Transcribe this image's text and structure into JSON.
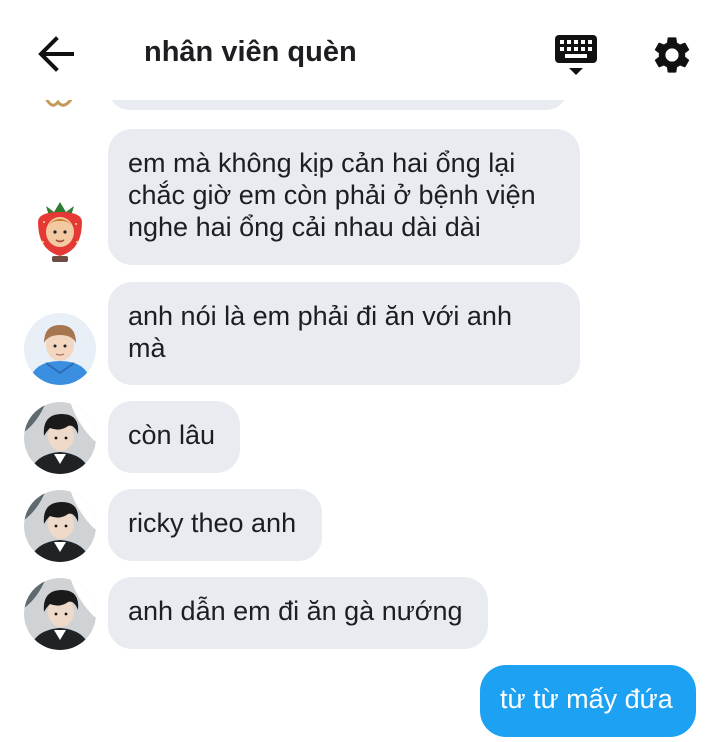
{
  "header": {
    "title": "nhân viên quèn",
    "back_icon": "arrow-left-icon",
    "keyboard_icon": "keyboard-icon",
    "settings_icon": "gear-icon"
  },
  "colors": {
    "incoming_bubble": "#e8ebef",
    "outgoing_bubble": "#1da1f2",
    "text": "#1c1e21"
  },
  "messages": [
    {
      "sender": "strawberry-avatar",
      "direction": "incoming",
      "text": "em mà không kịp cản hai ổng lại\nchắc giờ em còn phải ở bệnh viện\nnghe hai ổng cải nhau dài dài"
    },
    {
      "sender": "blue-hoodie-avatar",
      "direction": "incoming",
      "text": "anh nói là em phải đi ăn với anh\nmà"
    },
    {
      "sender": "dark-hair-avatar",
      "direction": "incoming",
      "text": "còn lâu"
    },
    {
      "sender": "dark-hair-avatar",
      "direction": "incoming",
      "text": "ricky theo anh"
    },
    {
      "sender": "dark-hair-avatar",
      "direction": "incoming",
      "text": "anh dẫn em đi ăn gà nướng"
    },
    {
      "sender": "me",
      "direction": "outgoing",
      "text": "từ từ mấy đứa"
    }
  ]
}
